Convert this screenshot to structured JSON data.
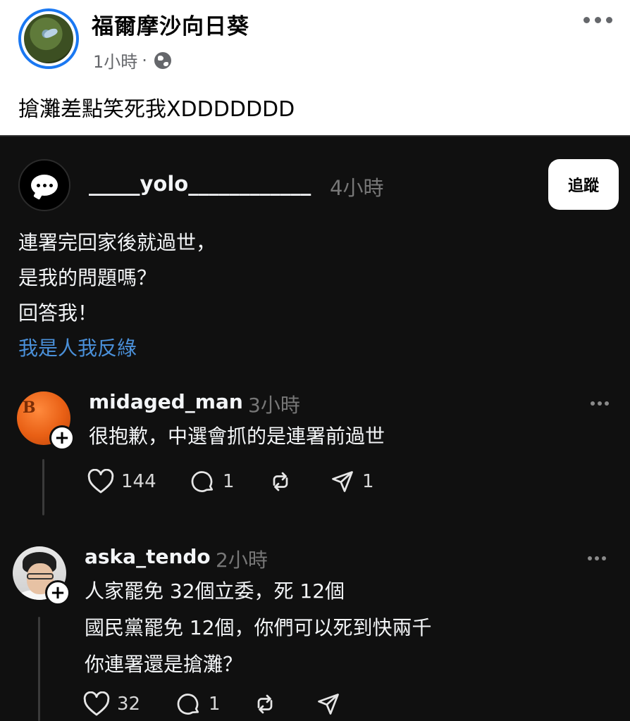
{
  "fb_post": {
    "page_name": "福爾摩沙向日葵",
    "time": "1小時",
    "separator": "·",
    "privacy_icon": "globe-icon",
    "more_icon": "more-horizontal-icon",
    "caption": "搶灘差點笑死我XDDDDDDD"
  },
  "threads_post": {
    "username": "_____yolo____________",
    "time": "4小時",
    "follow_label": "追蹤",
    "body_lines": [
      "連署完回家後就過世，",
      "是我的問題嗎？",
      "回答我！"
    ],
    "tag": "我是人我反綠"
  },
  "replies": [
    {
      "username": "midaged_man",
      "time": "3小時",
      "lines": [
        "很抱歉，中選會抓的是連署前過世"
      ],
      "likes": "144",
      "comments": "1",
      "reposts": "",
      "shares": "1"
    },
    {
      "username": "aska_tendo",
      "time": "2小時",
      "lines": [
        "人家罷免 32個立委，死 12個",
        "國民黨罷免 12個，你們可以死到快兩千",
        "你連署還是搶灘？"
      ],
      "likes": "32",
      "comments": "1",
      "reposts": "",
      "shares": ""
    }
  ],
  "colors": {
    "fb_accent": "#1a78f2",
    "threads_bg": "#101010",
    "tag_link": "#4a90d9",
    "muted_text": "#777777"
  }
}
